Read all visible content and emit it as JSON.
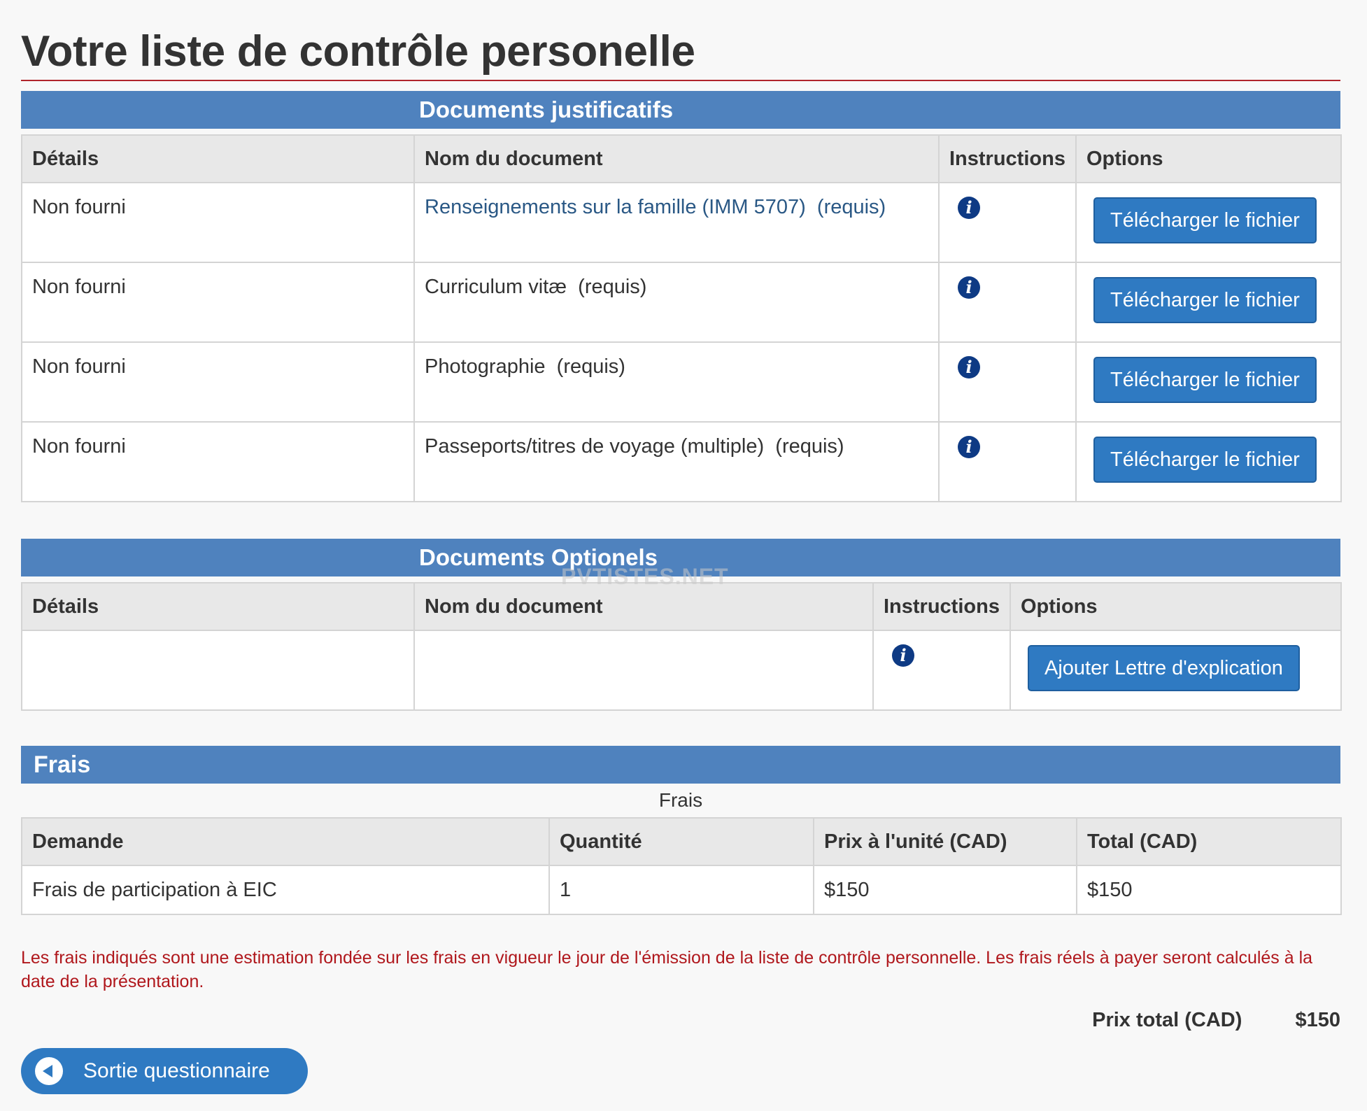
{
  "page": {
    "title": "Votre liste de contrôle personelle"
  },
  "supporting": {
    "heading": "Documents justificatifs",
    "columns": {
      "details": "Détails",
      "name": "Nom du document",
      "instructions": "Instructions",
      "options": "Options"
    },
    "rows": [
      {
        "details": "Non fourni",
        "name": "Renseignements sur la famille (IMM 5707)",
        "required": "(requis)",
        "button": "Télécharger le fichier"
      },
      {
        "details": "Non fourni",
        "name": "Curriculum vitæ",
        "required": "(requis)",
        "button": "Télécharger le fichier"
      },
      {
        "details": "Non fourni",
        "name": "Photographie",
        "required": "(requis)",
        "button": "Télécharger le fichier"
      },
      {
        "details": "Non fourni",
        "name": "Passeports/titres de voyage (multiple)",
        "required": "(requis)",
        "button": "Télécharger le fichier"
      }
    ],
    "info_icon": "info-icon"
  },
  "optional": {
    "heading": "Documents Optionels",
    "watermark": "PVTISTES.NET",
    "columns": {
      "details": "Détails",
      "name": "Nom du document",
      "instructions": "Instructions",
      "options": "Options"
    },
    "row": {
      "details": "",
      "name": "",
      "button": "Ajouter Lettre d'explication"
    }
  },
  "fees": {
    "heading": "Frais",
    "caption": "Frais",
    "columns": {
      "request": "Demande",
      "quantity": "Quantité",
      "unit_price": "Prix à l'unité (CAD)",
      "total": "Total (CAD)"
    },
    "row": {
      "request": "Frais de participation à EIC",
      "quantity": "1",
      "unit_price": "$150",
      "total": "$150"
    },
    "notice": "Les frais indiqués sont une estimation fondée sur les frais en vigueur le jour de l'émission de la liste de contrôle personnelle. Les frais réels à payer seront calculés à la date de la présentation.",
    "total_label": "Prix total (CAD)",
    "total_value": "$150"
  },
  "exit_button": {
    "label": "Sortie questionnaire",
    "icon": "back-arrow-icon"
  },
  "colors": {
    "section_header": "#4f82be",
    "button": "#2f7ac2",
    "notice": "#b0171c",
    "title_rule": "#b0242b"
  }
}
